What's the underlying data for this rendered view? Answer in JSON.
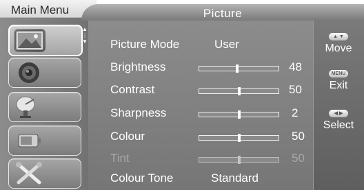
{
  "tabs": {
    "main_menu": "Main Menu",
    "current": "Picture"
  },
  "sidebar": {
    "items": [
      {
        "name": "picture",
        "selected": true
      },
      {
        "name": "sound",
        "selected": false
      },
      {
        "name": "channel",
        "selected": false
      },
      {
        "name": "feature",
        "selected": false
      },
      {
        "name": "setup",
        "selected": false
      }
    ]
  },
  "settings": {
    "picture_mode": {
      "label": "Picture Mode",
      "value": "User"
    },
    "brightness": {
      "label": "Brightness",
      "value": "48"
    },
    "contrast": {
      "label": "Contrast",
      "value": "50"
    },
    "sharpness": {
      "label": "Sharpness",
      "value": "2"
    },
    "colour": {
      "label": "Colour",
      "value": "50"
    },
    "tint": {
      "label": "Tint",
      "value": "50",
      "disabled": true
    },
    "colour_tone": {
      "label": "Colour Tone",
      "value": "Standard"
    }
  },
  "hints": {
    "move": "Move",
    "exit": "Exit",
    "exit_button": "MENU",
    "select": "Select"
  },
  "colors": {
    "panel": "#7f7f7f",
    "header": "#9a9a9a",
    "text": "#ffffff",
    "disabled_text": "#a8a8a8"
  }
}
